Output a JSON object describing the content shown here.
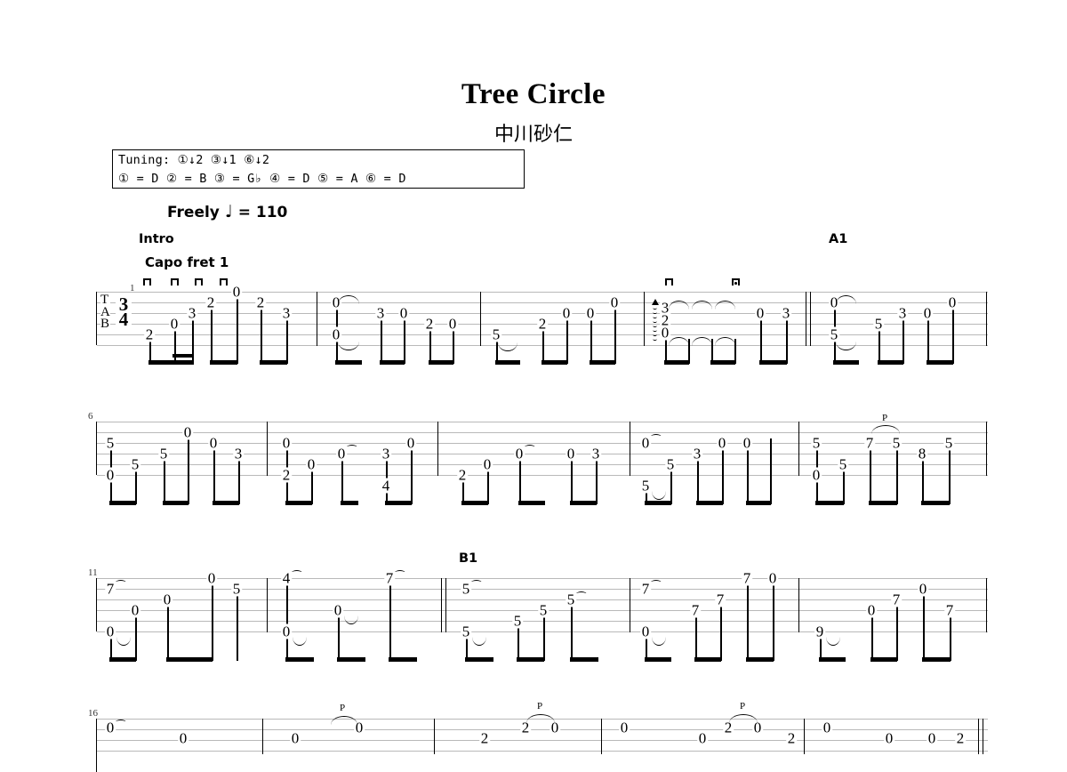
{
  "header": {
    "title": "Tree Circle",
    "composer": "中川砂仁",
    "tempo": "Freely",
    "tempo_note": "♩",
    "tempo_equals": "=",
    "tempo_bpm": "110"
  },
  "tuning": {
    "label": "Tuning:",
    "changes": "①↓2 ③↓1 ⑥↓2",
    "line1": "Tuning: ①↓2 ③↓1 ⑥↓2",
    "line2": "① = D  ② = B  ③ = G♭  ④ = D   ⑤ = A   ⑥ = D",
    "strings": [
      {
        "string": "①",
        "note": "D"
      },
      {
        "string": "②",
        "note": "B"
      },
      {
        "string": "③",
        "note": "G♭"
      },
      {
        "string": "④",
        "note": "D"
      },
      {
        "string": "⑤",
        "note": "A"
      },
      {
        "string": "⑥",
        "note": "D"
      }
    ]
  },
  "staff": {
    "clef": "TAB",
    "clef_letters": [
      "T",
      "A",
      "B"
    ],
    "time_signature_top": "3",
    "time_signature_bottom": "4",
    "string_count": 6
  },
  "directions": {
    "intro": "Intro",
    "capo": "Capo fret 1",
    "section_a1": "A1",
    "section_b1": "B1",
    "pull_off": "P"
  },
  "systems": [
    {
      "number": "1",
      "measures": [
        {
          "index": "1",
          "notes": [
            {
              "string": 6,
              "fret": "2"
            },
            {
              "string": 5,
              "fret": "0"
            },
            {
              "string": 4,
              "fret": "3"
            },
            {
              "string": 3,
              "fret": "2"
            },
            {
              "string": 1,
              "fret": "0"
            },
            {
              "string": 3,
              "fret": "2"
            },
            {
              "string": 4,
              "fret": "3"
            }
          ]
        },
        {
          "index": "2",
          "notes": [
            {
              "string": 2,
              "fret": "0"
            },
            {
              "string": 5,
              "fret": "0"
            },
            {
              "string": 4,
              "fret": "3"
            },
            {
              "string": 3,
              "fret": "0"
            },
            {
              "string": 4,
              "fret": "2"
            },
            {
              "string": 4,
              "fret": "0"
            }
          ]
        },
        {
          "index": "3",
          "notes": [
            {
              "string": 5,
              "fret": "5"
            },
            {
              "string": 4,
              "fret": "2"
            },
            {
              "string": 3,
              "fret": "0"
            },
            {
              "string": 2,
              "fret": "0"
            },
            {
              "string": 1,
              "fret": "0"
            }
          ]
        },
        {
          "index": "4",
          "notes": [
            {
              "string": 2,
              "fret": "3"
            },
            {
              "string": 3,
              "fret": "2"
            },
            {
              "string": 4,
              "fret": "0"
            },
            {
              "string": 2,
              "fret": "0"
            },
            {
              "string": 2,
              "fret": "3"
            }
          ]
        },
        {
          "index": "5",
          "notes": [
            {
              "string": 2,
              "fret": "0"
            },
            {
              "string": 5,
              "fret": "5"
            },
            {
              "string": 3,
              "fret": "5"
            },
            {
              "string": 2,
              "fret": "3"
            },
            {
              "string": 2,
              "fret": "0"
            },
            {
              "string": 1,
              "fret": "0"
            }
          ]
        }
      ]
    },
    {
      "number": "6",
      "measures": [
        {
          "index": "6",
          "notes": [
            {
              "string": 2,
              "fret": "5"
            },
            {
              "string": 4,
              "fret": "0"
            },
            {
              "string": 3,
              "fret": "5"
            },
            {
              "string": 3,
              "fret": "5"
            },
            {
              "string": 1,
              "fret": "0"
            },
            {
              "string": 2,
              "fret": "0"
            },
            {
              "string": 2,
              "fret": "3"
            }
          ]
        },
        {
          "index": "7",
          "notes": [
            {
              "string": 2,
              "fret": "0"
            },
            {
              "string": 4,
              "fret": "2"
            },
            {
              "string": 3,
              "fret": "0"
            },
            {
              "string": 2,
              "fret": "0"
            },
            {
              "string": 2,
              "fret": "3"
            },
            {
              "string": 4,
              "fret": "4"
            },
            {
              "string": 1,
              "fret": "0"
            }
          ]
        },
        {
          "index": "8",
          "notes": [
            {
              "string": 4,
              "fret": "2"
            },
            {
              "string": 3,
              "fret": "0"
            },
            {
              "string": 2,
              "fret": "0"
            },
            {
              "string": 2,
              "fret": "0"
            },
            {
              "string": 2,
              "fret": "3"
            }
          ]
        },
        {
          "index": "9",
          "notes": [
            {
              "string": 2,
              "fret": "0"
            },
            {
              "string": 4,
              "fret": "5"
            },
            {
              "string": 3,
              "fret": "5"
            },
            {
              "string": 2,
              "fret": "3"
            },
            {
              "string": 2,
              "fret": "0"
            },
            {
              "string": 1,
              "fret": "0"
            }
          ]
        },
        {
          "index": "10",
          "notes": [
            {
              "string": 2,
              "fret": "5"
            },
            {
              "string": 4,
              "fret": "0"
            },
            {
              "string": 3,
              "fret": "5"
            },
            {
              "string": 2,
              "fret": "7"
            },
            {
              "string": 2,
              "fret": "5"
            },
            {
              "string": 3,
              "fret": "8"
            },
            {
              "string": 2,
              "fret": "5"
            }
          ]
        }
      ]
    },
    {
      "number": "11",
      "measures": [
        {
          "index": "11",
          "notes": [
            {
              "string": 2,
              "fret": "7"
            },
            {
              "string": 5,
              "fret": "0"
            },
            {
              "string": 3,
              "fret": "0"
            },
            {
              "string": 3,
              "fret": "0"
            },
            {
              "string": 1,
              "fret": "0"
            },
            {
              "string": 2,
              "fret": "5"
            }
          ]
        },
        {
          "index": "12",
          "notes": [
            {
              "string": 1,
              "fret": "4"
            },
            {
              "string": 5,
              "fret": "0"
            },
            {
              "string": 3,
              "fret": "0"
            },
            {
              "string": 1,
              "fret": "7"
            }
          ]
        },
        {
          "index": "13",
          "notes": [
            {
              "string": 2,
              "fret": "5"
            },
            {
              "string": 5,
              "fret": "5"
            },
            {
              "string": 4,
              "fret": "5"
            },
            {
              "string": 3,
              "fret": "5"
            },
            {
              "string": 2,
              "fret": "5"
            }
          ]
        },
        {
          "index": "14",
          "notes": [
            {
              "string": 2,
              "fret": "7"
            },
            {
              "string": 5,
              "fret": "0"
            },
            {
              "string": 4,
              "fret": "7"
            },
            {
              "string": 3,
              "fret": "7"
            },
            {
              "string": 1,
              "fret": "7"
            },
            {
              "string": 1,
              "fret": "0"
            }
          ]
        },
        {
          "index": "15",
          "notes": [
            {
              "string": 5,
              "fret": "9"
            },
            {
              "string": 4,
              "fret": "0"
            },
            {
              "string": 3,
              "fret": "7"
            },
            {
              "string": 2,
              "fret": "0"
            },
            {
              "string": 3,
              "fret": "7"
            }
          ]
        }
      ]
    },
    {
      "number": "16",
      "measures": [
        {
          "index": "16",
          "notes": [
            {
              "string": 2,
              "fret": "0"
            },
            {
              "string": 4,
              "fret": "0"
            }
          ]
        },
        {
          "index": "17",
          "notes": [
            {
              "string": 3,
              "fret": "0"
            },
            {
              "string": 2,
              "fret": "0"
            },
            {
              "string": 3,
              "fret": "2"
            },
            {
              "string": 3,
              "fret": "0"
            },
            {
              "string": 4,
              "fret": "2"
            }
          ]
        },
        {
          "index": "18",
          "notes": [
            {
              "string": 3,
              "fret": "0"
            },
            {
              "string": 3,
              "fret": "0"
            },
            {
              "string": 3,
              "fret": "2"
            },
            {
              "string": 3,
              "fret": "0"
            },
            {
              "string": 4,
              "fret": "2"
            }
          ]
        },
        {
          "index": "19",
          "notes": [
            {
              "string": 2,
              "fret": "0"
            },
            {
              "string": 3,
              "fret": "0"
            },
            {
              "string": 3,
              "fret": "0"
            },
            {
              "string": 3,
              "fret": "2"
            }
          ]
        }
      ]
    }
  ]
}
